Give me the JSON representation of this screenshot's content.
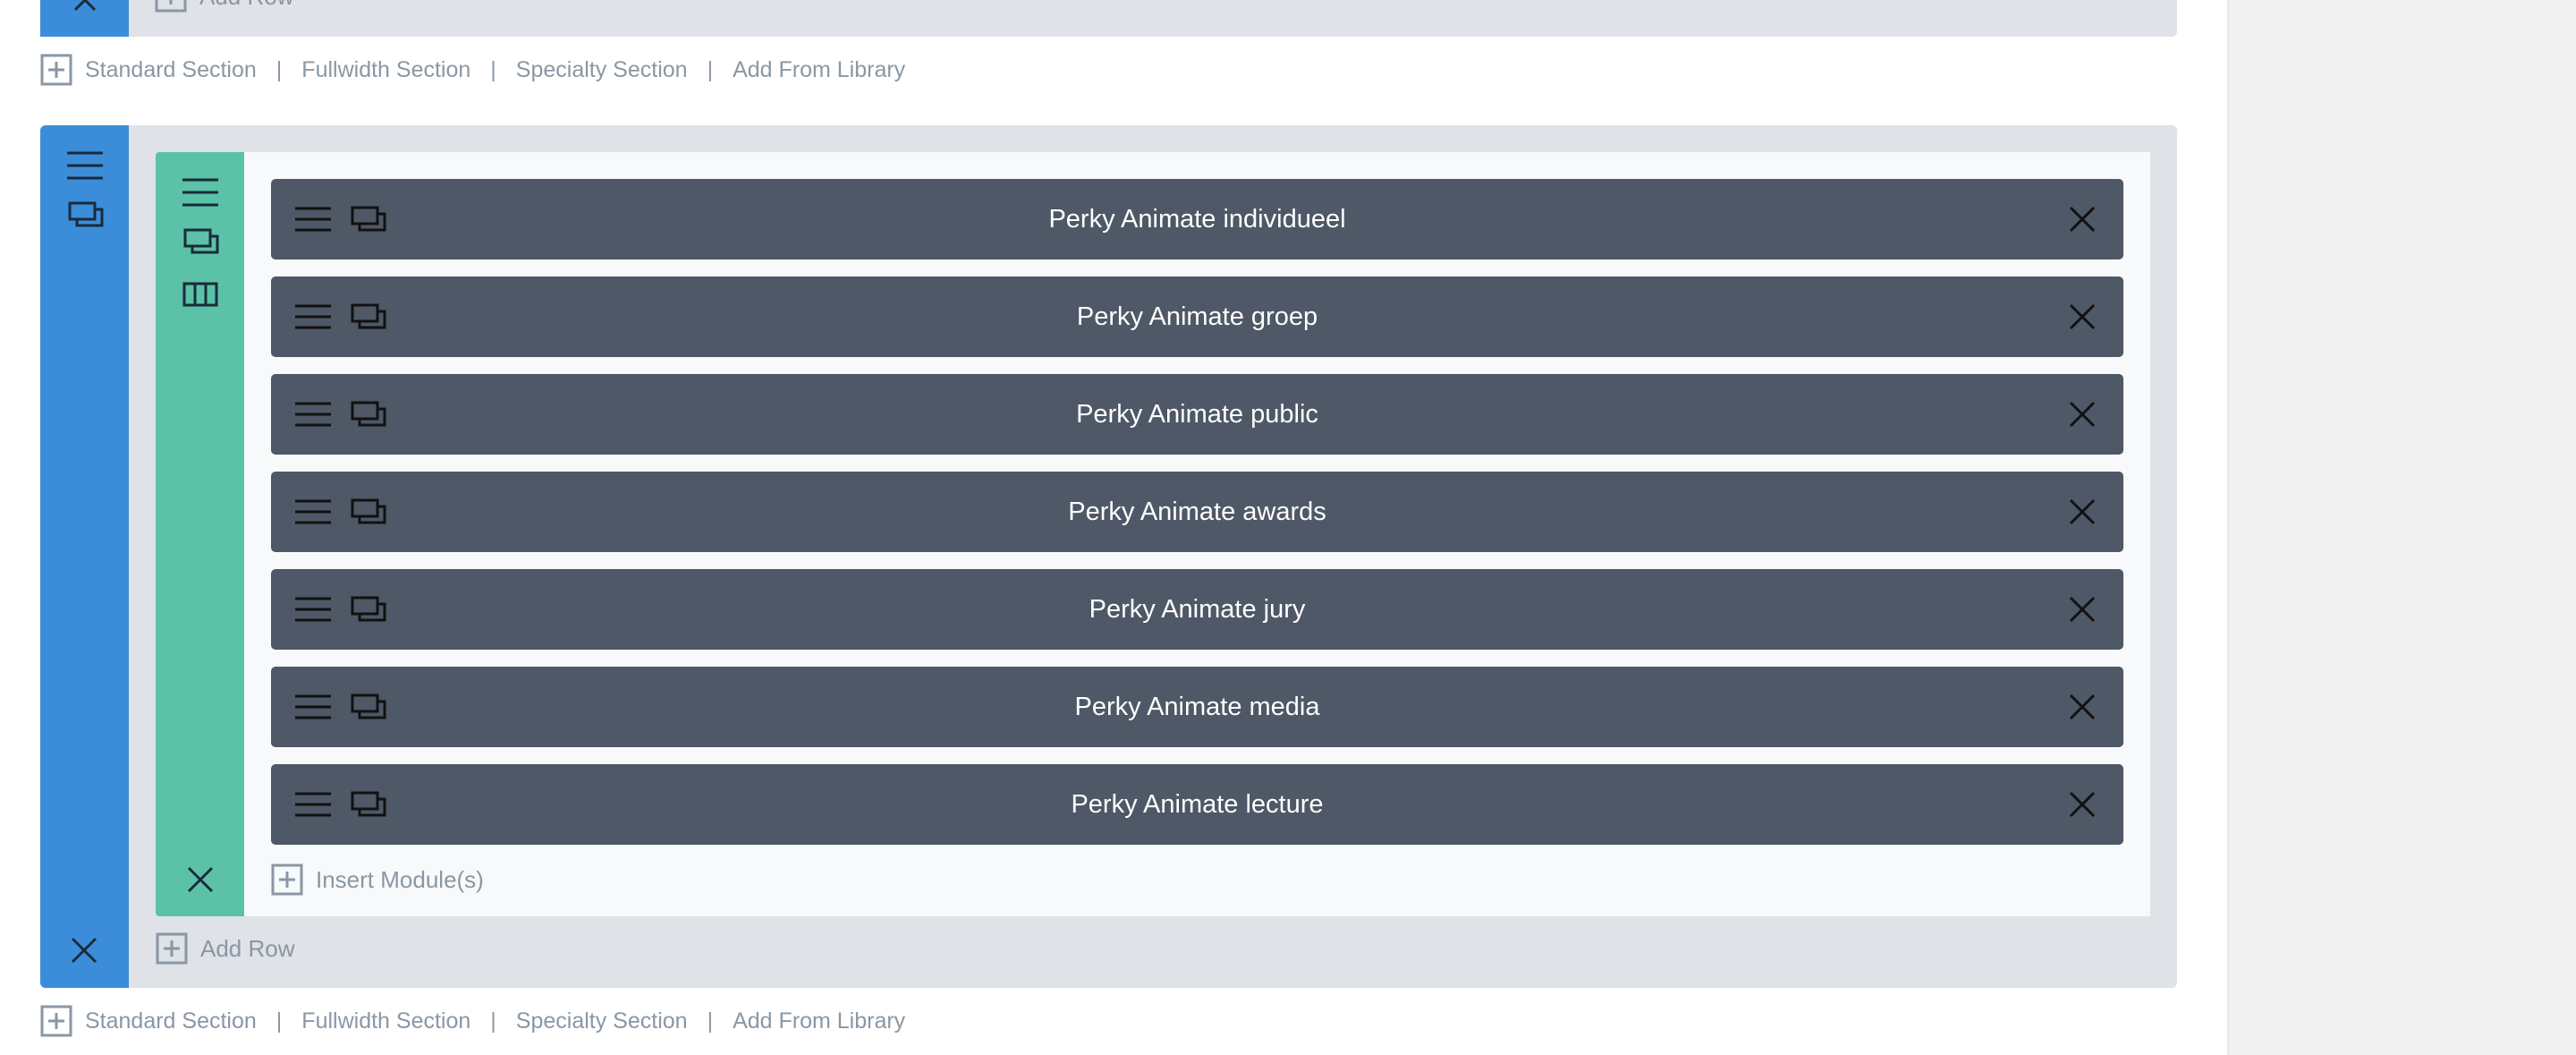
{
  "top_section": {
    "add_row_label": "Add Row"
  },
  "section_links": {
    "standard": "Standard Section",
    "fullwidth": "Fullwidth Section",
    "specialty": "Specialty Section",
    "library": "Add From Library",
    "separator": "|"
  },
  "modules": [
    {
      "title": "Perky Animate individueel"
    },
    {
      "title": "Perky Animate groep"
    },
    {
      "title": "Perky Animate public"
    },
    {
      "title": "Perky Animate awards"
    },
    {
      "title": "Perky Animate jury"
    },
    {
      "title": "Perky Animate media"
    },
    {
      "title": "Perky Animate lecture"
    }
  ],
  "column": {
    "insert_label": "Insert Module(s)"
  },
  "section": {
    "add_row_label": "Add Row"
  },
  "colors": {
    "section_blue": "#3c8dd9",
    "row_green": "#5bc2a7",
    "module_bg": "#4e5866",
    "section_bg": "#dfe2e7",
    "link_text": "#8a97a4"
  },
  "icons": {
    "drag": "hamburger-icon",
    "duplicate": "duplicate-icon",
    "columns": "columns-icon",
    "delete": "close-icon",
    "add": "plus-square-icon"
  }
}
